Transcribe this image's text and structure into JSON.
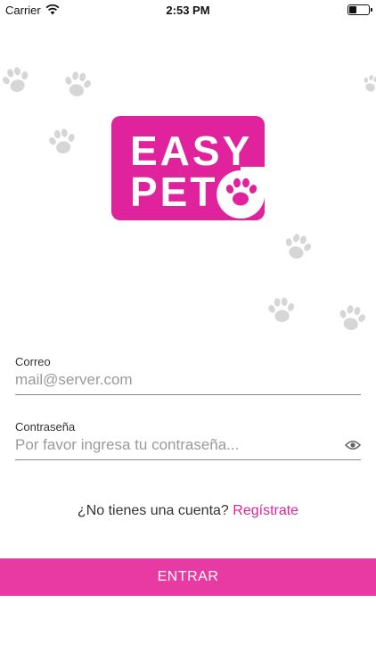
{
  "status_bar": {
    "carrier": "Carrier",
    "time": "2:53 PM",
    "battery_level": 0.4
  },
  "logo": {
    "line1": "EASY",
    "line2": "PET",
    "color": "#e0239d"
  },
  "decorations": {
    "icon": "paw-print-icon",
    "color": "#d6d6d6"
  },
  "form": {
    "email": {
      "label": "Correo",
      "placeholder": "mail@server.com",
      "value": ""
    },
    "password": {
      "label": "Contraseña",
      "placeholder": "Por favor ingresa tu contraseña...",
      "value": "",
      "toggle_icon": "eye-icon"
    }
  },
  "register": {
    "prompt": "¿No tienes una cuenta?",
    "link": "Regístrate"
  },
  "submit": {
    "label": "ENTRAR",
    "color": "#e83aa3"
  }
}
